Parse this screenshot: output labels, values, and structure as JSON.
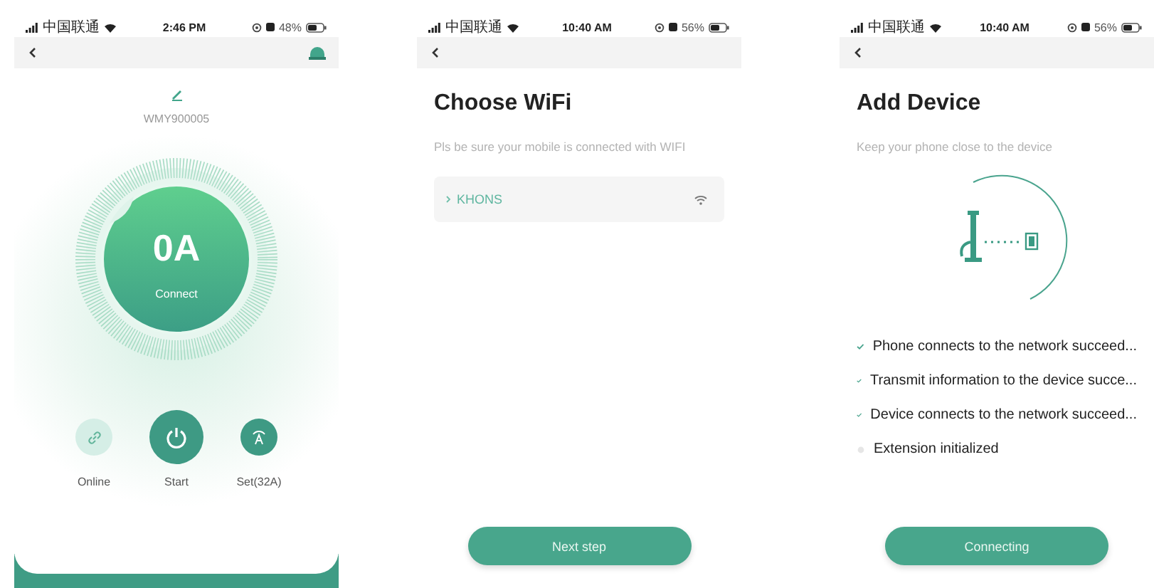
{
  "device_screen": {
    "status_bar": {
      "carrier": "中国联通",
      "time": "2:46 PM",
      "battery": "48%"
    },
    "device_name": "WMY900005",
    "reading": "0A",
    "state_label": "Connect",
    "actions": [
      {
        "kind": "link",
        "label": "Online"
      },
      {
        "kind": "power",
        "label": "Start"
      },
      {
        "kind": "current",
        "label": "Set(32A)"
      }
    ]
  },
  "wifi_screen": {
    "status_bar": {
      "carrier": "中国联通",
      "time": "10:40 AM",
      "battery": "56%"
    },
    "title": "Choose WiFi",
    "hint": "Pls be sure your mobile is connected with WIFI",
    "networks": [
      {
        "name": "KHONS"
      }
    ],
    "button": "Next step"
  },
  "add_device_screen": {
    "status_bar": {
      "carrier": "中国联通",
      "time": "10:40 AM",
      "battery": "56%"
    },
    "title": "Add Device",
    "hint": "Keep your phone close to the device",
    "steps": [
      {
        "label": "Phone connects to the network succeed...",
        "done": true
      },
      {
        "label": "Transmit information to the device succe...",
        "done": true
      },
      {
        "label": "Device connects to the network succeed...",
        "done": true
      },
      {
        "label": "Extension initialized",
        "done": false
      }
    ],
    "button": "Connecting"
  }
}
